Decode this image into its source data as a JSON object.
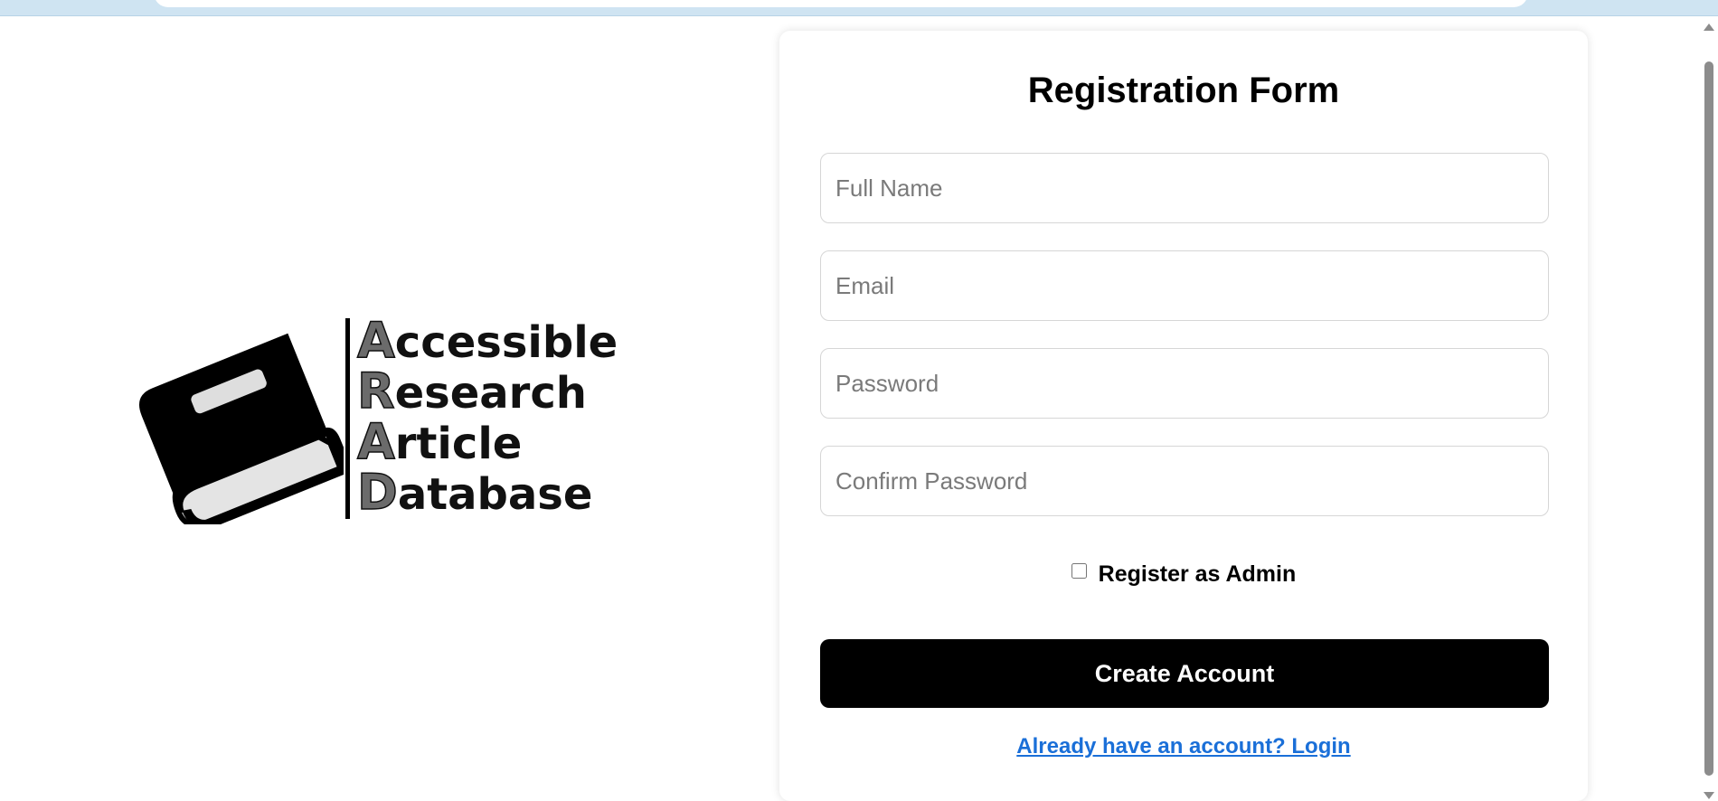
{
  "logo": {
    "lines": [
      {
        "cap": "A",
        "rest": "ccessible"
      },
      {
        "cap": "R",
        "rest": "esearch"
      },
      {
        "cap": "A",
        "rest": "rticle"
      },
      {
        "cap": "D",
        "rest": "atabase"
      }
    ],
    "icon": "book-icon"
  },
  "form": {
    "title": "Registration Form",
    "fields": {
      "full_name_placeholder": "Full Name",
      "email_placeholder": "Email",
      "password_placeholder": "Password",
      "confirm_password_placeholder": "Confirm Password"
    },
    "admin_checkbox_label": "Register as Admin",
    "admin_checked": false,
    "submit_label": "Create Account",
    "login_link_text": "Already have an account? Login"
  },
  "colors": {
    "button_bg": "#000000",
    "link": "#1a6fd8",
    "browser_strip": "#cfe4f2"
  }
}
